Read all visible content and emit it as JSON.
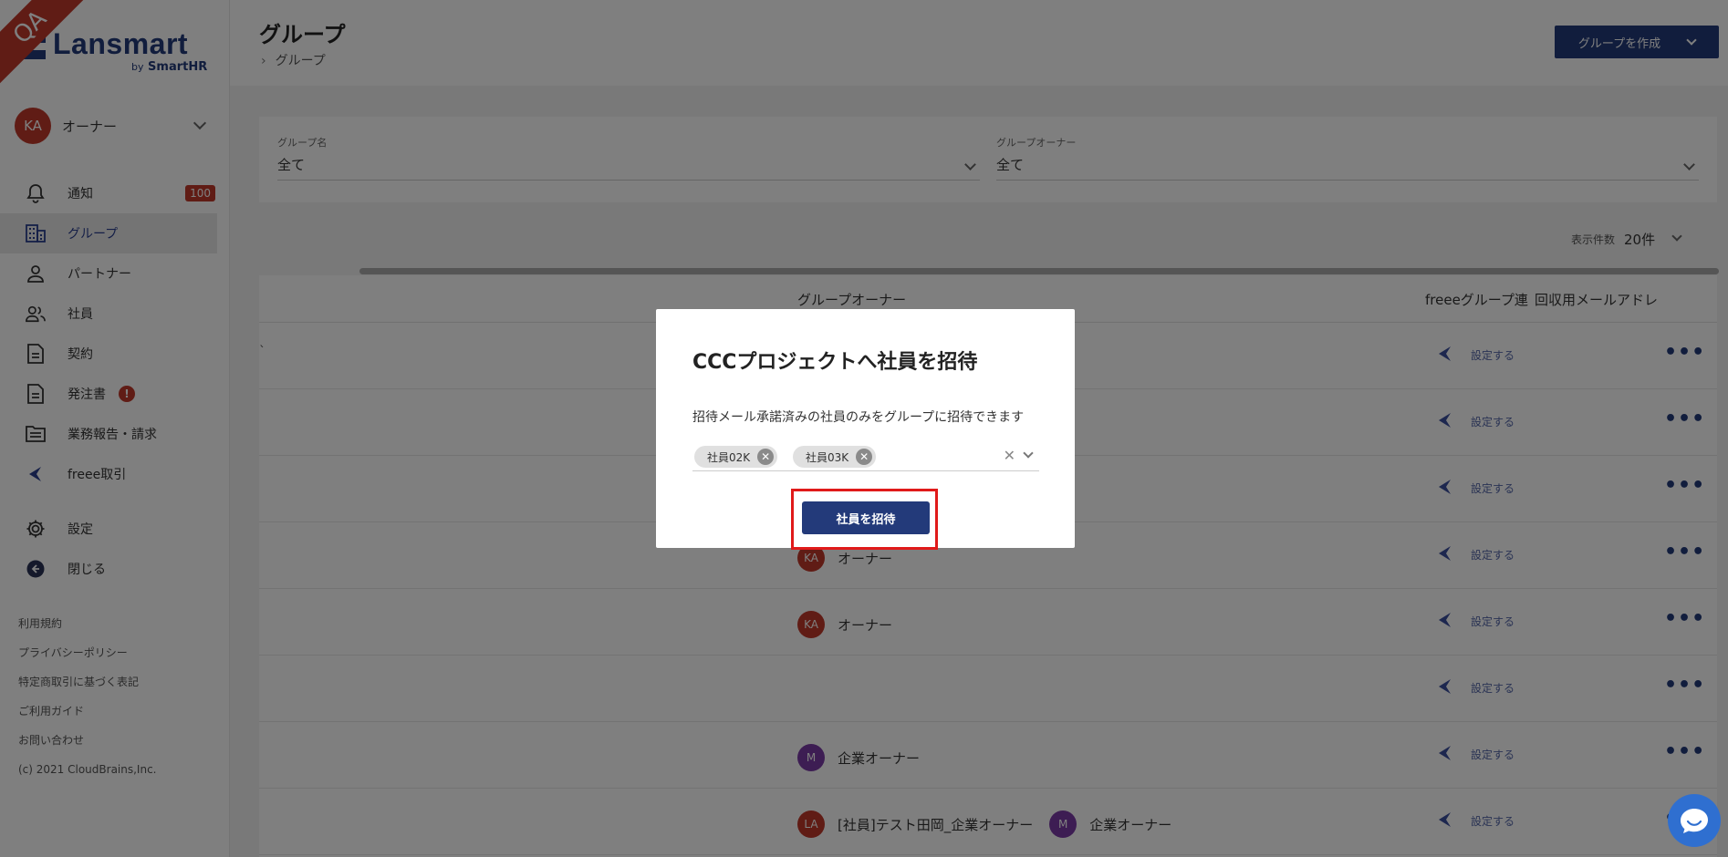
{
  "sidebar": {
    "qa_label": "QA",
    "logo_text": "Lansmart",
    "logo_sub_by": "by",
    "logo_sub_brand": "SmartHR",
    "user": {
      "initials": "KA",
      "name": "オーナー"
    },
    "nav": [
      {
        "label": "通知",
        "icon": "bell-icon",
        "badge": "100"
      },
      {
        "label": "グループ",
        "icon": "building-icon",
        "active": true
      },
      {
        "label": "パートナー",
        "icon": "person-icon"
      },
      {
        "label": "社員",
        "icon": "people-icon"
      },
      {
        "label": "契約",
        "icon": "document-icon"
      },
      {
        "label": "発注書",
        "icon": "document-icon",
        "alert": "!"
      },
      {
        "label": "業務報告・請求",
        "icon": "folder-icon"
      },
      {
        "label": "freee取引",
        "icon": "freee-icon"
      },
      {
        "label": "設定",
        "icon": "gear-icon"
      },
      {
        "label": "閉じる",
        "icon": "collapse-icon"
      }
    ],
    "footer_links": [
      "利用規約",
      "プライバシーポリシー",
      "特定商取引に基づく表記",
      "ご利用ガイド",
      "お問い合わせ",
      "(c) 2021 CloudBrains,Inc."
    ]
  },
  "header": {
    "title": "グループ",
    "breadcrumb": "グループ",
    "create_button": "グループを作成"
  },
  "filters": {
    "group_name_label": "グループ名",
    "group_name_value": "全て",
    "group_owner_label": "グループオーナー",
    "group_owner_value": "全て"
  },
  "per_page": {
    "label": "表示件数",
    "value": "20件"
  },
  "table": {
    "headers": {
      "owner": "グループオーナー",
      "freee": "freeeグループ連",
      "email": "回収用メールアドレ"
    },
    "first_row_fragment": "`",
    "freee_action": "設定する",
    "rows": [
      {
        "owners": []
      },
      {
        "owners": []
      },
      {
        "owners": []
      },
      {
        "owners": [
          {
            "initials": "KA",
            "name": "オーナー",
            "color": "#c0392b"
          }
        ]
      },
      {
        "owners": [
          {
            "initials": "KA",
            "name": "オーナー",
            "color": "#c0392b"
          }
        ]
      },
      {
        "owners": []
      },
      {
        "owners": [
          {
            "initials": "M",
            "name": "企業オーナー",
            "color": "#7b3aa6"
          }
        ]
      },
      {
        "owners": [
          {
            "initials": "LA",
            "name": "[社員]テスト田岡_企業オーナー",
            "color": "#c0392b"
          },
          {
            "initials": "M",
            "name": "企業オーナー",
            "color": "#7b3aa6"
          }
        ]
      }
    ]
  },
  "modal": {
    "title": "CCCプロジェクトへ社員を招待",
    "description": "招待メール承諾済みの社員のみをグループに招待できます",
    "chips": [
      "社員02K",
      "社員03K"
    ],
    "invite_button": "社員を招待"
  },
  "colors": {
    "primary": "#233a7a",
    "danger": "#c0392b",
    "highlight": "#e01a1a"
  }
}
